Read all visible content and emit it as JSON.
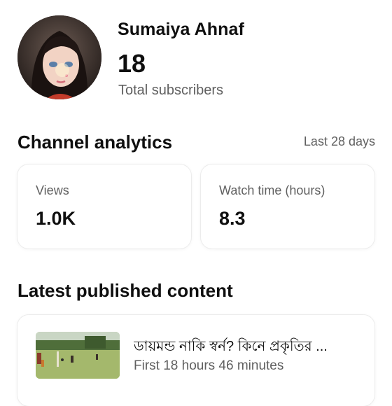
{
  "channel": {
    "name": "Sumaiya Ahnaf",
    "subscriber_count": "18",
    "subscriber_label": "Total subscribers"
  },
  "analytics": {
    "title": "Channel analytics",
    "range": "Last 28 days",
    "cards": [
      {
        "label": "Views",
        "value": "1.0K"
      },
      {
        "label": "Watch time (hours)",
        "value": "8.3"
      }
    ]
  },
  "latest": {
    "title": "Latest published content",
    "video": {
      "title": "ডায়মন্ড নাকি স্বর্ন? কিনে প্রকৃতির ...",
      "meta": "First 18 hours 46 minutes"
    }
  }
}
